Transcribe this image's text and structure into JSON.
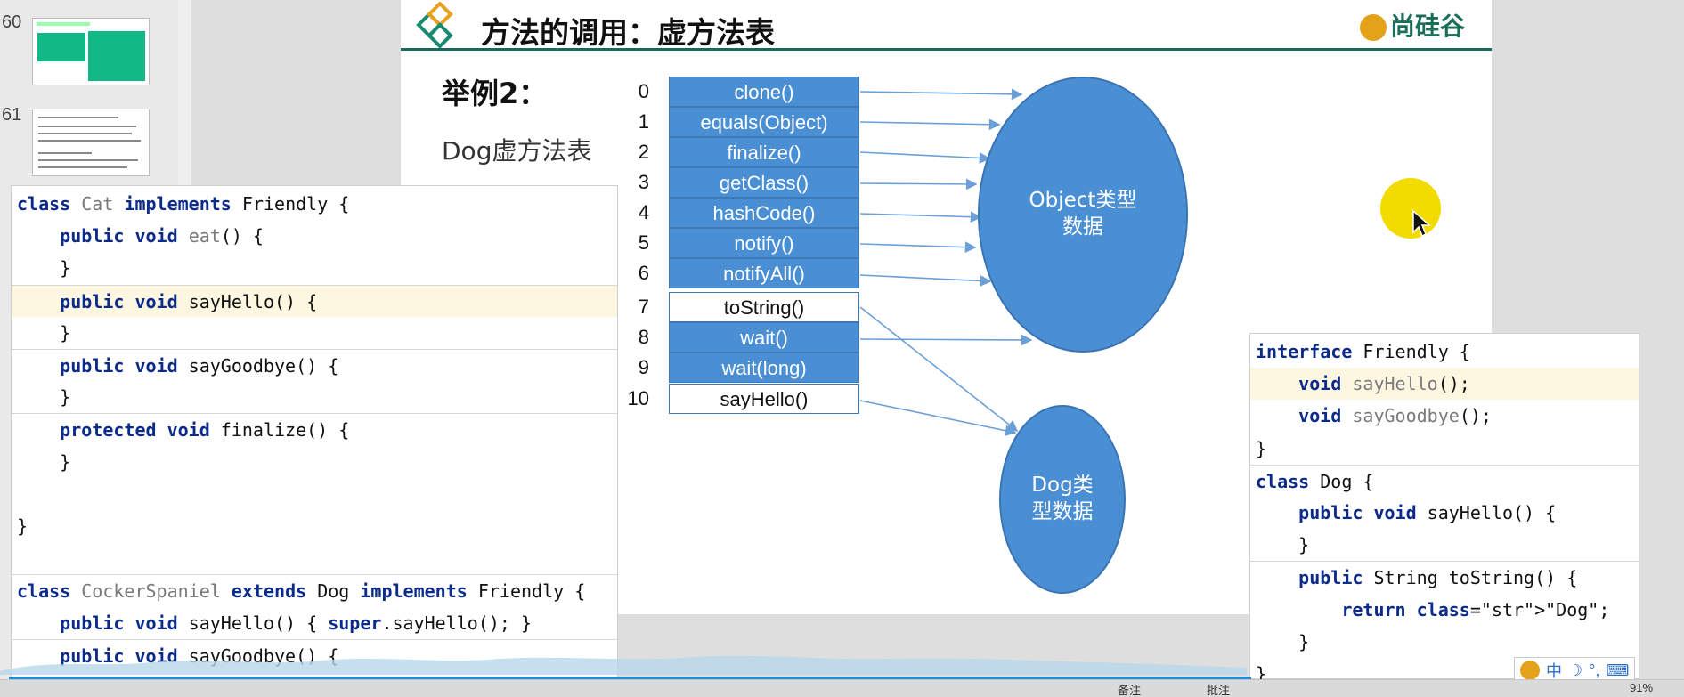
{
  "thumbnails": [
    {
      "number": "60"
    },
    {
      "number": "61"
    }
  ],
  "slide": {
    "title": "方法的调用：虚方法表",
    "brand": "尚硅谷",
    "example_label": "举例2：",
    "subtitle": "Dog虚方法表",
    "vtable": [
      {
        "index": "0",
        "method": "clone()",
        "inherited": true
      },
      {
        "index": "1",
        "method": "equals(Object)",
        "inherited": true
      },
      {
        "index": "2",
        "method": "finalize()",
        "inherited": true
      },
      {
        "index": "3",
        "method": "getClass()",
        "inherited": true
      },
      {
        "index": "4",
        "method": "hashCode()",
        "inherited": true
      },
      {
        "index": "5",
        "method": "notify()",
        "inherited": true
      },
      {
        "index": "6",
        "method": "notifyAll()",
        "inherited": true
      },
      {
        "index": "7",
        "method": "toString()",
        "inherited": false
      },
      {
        "index": "8",
        "method": "wait()",
        "inherited": true
      },
      {
        "index": "9",
        "method": "wait(long)",
        "inherited": true
      },
      {
        "index": "10",
        "method": "sayHello()",
        "inherited": false
      }
    ],
    "object_oval_label": "Object类型\n数据",
    "dog_oval_label": "Dog类\n型数据"
  },
  "left_code": {
    "lines": [
      "class Cat implements Friendly {",
      "    public void eat() {",
      "    }",
      "    public void sayHello() {",
      "    }",
      "    public void sayGoodbye() {",
      "    }",
      "    protected void finalize() {",
      "    }",
      "",
      "}",
      "",
      "class CockerSpaniel extends Dog implements Friendly {",
      "    public void sayHello() { super.sayHello(); }",
      "    public void sayGoodbye() {"
    ],
    "gutter_marks": [
      "6",
      "6",
      "6",
      "6",
      "6",
      "6"
    ]
  },
  "right_code": {
    "lines": [
      "interface Friendly {",
      "    void sayHello();",
      "    void sayGoodbye();",
      "}",
      "class Dog {",
      "    public void sayHello() {",
      "    }",
      "    public String toString() {",
      "        return \"Dog\";",
      "    }",
      "}"
    ]
  },
  "status": {
    "notes": "备注",
    "comments": "批注",
    "zoom": "91%"
  },
  "ime": {
    "lang": "中",
    "moon": "☽",
    "punct": "°,",
    "keyboard": "⌨"
  },
  "colors": {
    "vtable_blue": "#4a8fd4",
    "accent_teal": "#1a6a5a",
    "keyword": "#0b2a8a",
    "string": "#067d17"
  }
}
